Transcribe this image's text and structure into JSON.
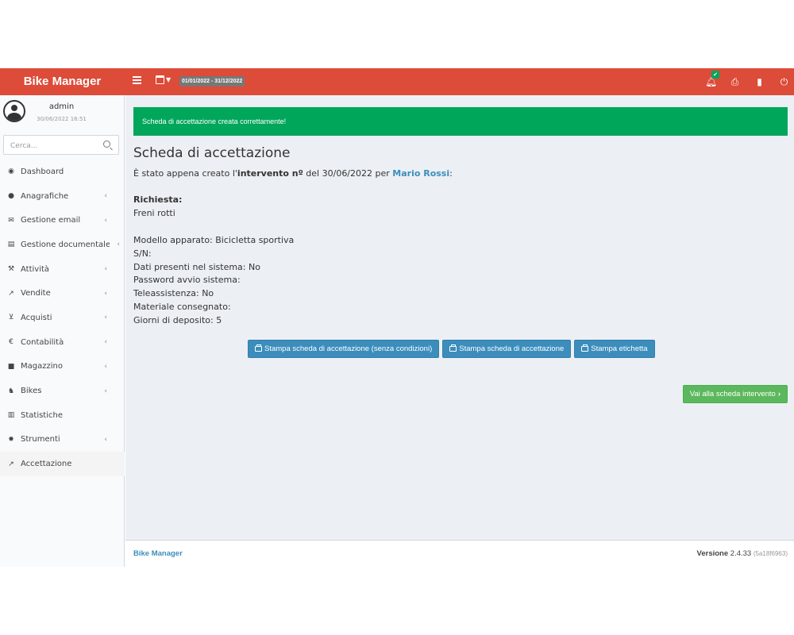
{
  "header": {
    "brand": "Bike Manager",
    "date_range": "01/01/2022 - 31/12/2022",
    "accent_color": "#dd4b39"
  },
  "user": {
    "name": "admin",
    "datetime": "30/06/2022 16:51"
  },
  "search": {
    "placeholder": "Cerca..."
  },
  "sidebar": {
    "items": [
      {
        "label": "Dashboard",
        "icon": "dashboard-icon"
      },
      {
        "label": "Anagrafiche",
        "icon": "users-icon"
      },
      {
        "label": "Gestione email",
        "icon": "envelope-icon"
      },
      {
        "label": "Gestione documentale",
        "icon": "document-icon"
      },
      {
        "label": "Attività",
        "icon": "wrench-icon"
      },
      {
        "label": "Vendite",
        "icon": "line-chart-icon"
      },
      {
        "label": "Acquisti",
        "icon": "cart-icon"
      },
      {
        "label": "Contabilità",
        "icon": "euro-icon"
      },
      {
        "label": "Magazzino",
        "icon": "truck-icon"
      },
      {
        "label": "Bikes",
        "icon": "bike-icon"
      },
      {
        "label": "Statistiche",
        "icon": "bar-chart-icon"
      },
      {
        "label": "Strumenti",
        "icon": "cog-icon"
      },
      {
        "label": "Accettazione",
        "icon": "external-link-icon"
      }
    ]
  },
  "alert": {
    "message": "Scheda di accettazione creata correttamente!"
  },
  "main": {
    "title": "Scheda di accettazione",
    "intro_prefix": "È stato appena creato l'",
    "intro_bold": "intervento nº",
    "intro_middle": " del 30/06/2022 per ",
    "customer": "Mario Rossi",
    "intro_suffix": ":",
    "request_label": "Richiesta:",
    "request_value": "Freni rotti",
    "details": [
      "Modello apparato: Bicicletta sportiva",
      "S/N:",
      "Dati presenti nel sistema: No",
      "Password avvio sistema:",
      "Teleassistenza: No",
      "Materiale consegnato:",
      "Giorni di deposito: 5"
    ],
    "buttons": {
      "print_no_conditions": "Stampa scheda di accettazione (senza condizioni)",
      "print_sheet": "Stampa scheda di accettazione",
      "print_label": "Stampa etichetta",
      "goto_intervention": "Vai alla scheda intervento"
    }
  },
  "footer": {
    "brand": "Bike Manager",
    "version_label": "Versione",
    "version": "2.4.33",
    "hash": "(5a18f6963)"
  }
}
